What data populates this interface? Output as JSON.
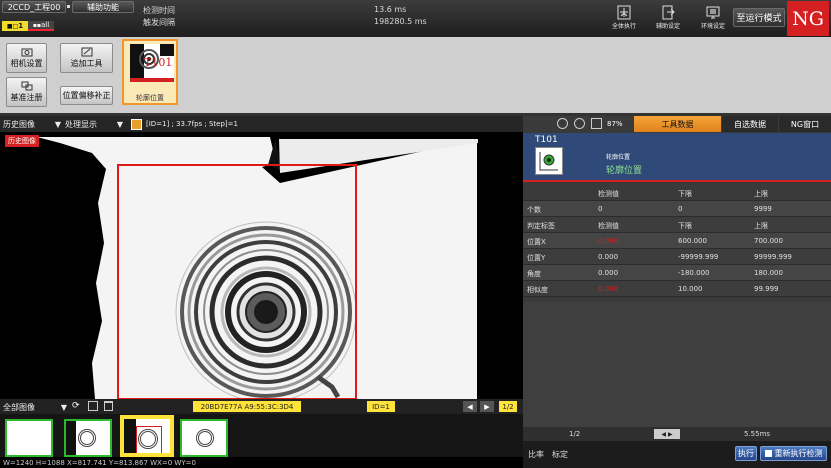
{
  "header": {
    "project_tab": "2CCD_工程00",
    "aux_tab": "辅助功能",
    "tab_small_1": "1",
    "tab_small_2": "all",
    "detect_time_label": "检测时间",
    "trigger_interval_label": "触发间隔",
    "detect_time_value": "13.6 ms",
    "trigger_interval_value": "198280.5 ms",
    "icons": [
      {
        "name": "all-execute",
        "label": "全体执行",
        "icon": "cross-icon"
      },
      {
        "name": "aux-settings",
        "label": "辅助设定",
        "icon": "export-icon"
      },
      {
        "name": "env-settings",
        "label": "环境设定",
        "icon": "monitor-icon"
      }
    ],
    "run_mode_button": "至运行模式",
    "ng_badge": "NG"
  },
  "tools": {
    "camera_settings": "相机设置",
    "register_base": "基准注册",
    "add_tool": "追加工具",
    "offset_correction": "位置偏移补正",
    "tool_card_label": "轮廓位置",
    "tool_card_id": "T101"
  },
  "view": {
    "history_select": "历史图像",
    "process_select": "处理显示",
    "info": "[ID=1] ; 33.7fps ; Step]=1",
    "history_badge": "历史图像",
    "zoom": "87%"
  },
  "right_tabs": [
    "工具数据",
    "自选数据",
    "NG窗口"
  ],
  "tool_info": {
    "id": "T101",
    "category": "轮廓位置",
    "name": "轮廓位置"
  },
  "table": {
    "headers": [
      "",
      "检测值",
      "下限",
      "上限"
    ],
    "rows": [
      {
        "label": "个数",
        "value": "0",
        "low": "0",
        "high": "9999",
        "red": false
      },
      {
        "label": "判定标签",
        "value": "检测值",
        "low": "下限",
        "high": "上限",
        "red": false
      },
      {
        "label": "位置X",
        "value": "0.000",
        "low": "600.000",
        "high": "700.000",
        "red": true
      },
      {
        "label": "位置Y",
        "value": "0.000",
        "low": "-99999.999",
        "high": "99999.999",
        "red": false
      },
      {
        "label": "角度",
        "value": "0.000",
        "low": "-180.000",
        "high": "180.000",
        "red": false
      },
      {
        "label": "相似度",
        "value": "0.000",
        "low": "10.000",
        "high": "99.999",
        "red": true
      }
    ],
    "page": "1/2",
    "time": "5.55ms"
  },
  "right_bottom": {
    "compare": "比率",
    "calibrate": "标定",
    "execute": "执行",
    "redetect": "重新执行检测"
  },
  "bottom": {
    "all_images_select": "全部图像",
    "image_name": "20BD7E77A A9:55:3C:3D4",
    "id_badge": "ID=1",
    "page_badge": "1/2"
  },
  "status_text": "W=1240 H=1088 X=817.741 Y=813.867 WX=0 WY=0",
  "colors": {
    "accent_orange": "#f0962a",
    "ng_red": "#d42020",
    "ok_green": "#2db82d",
    "highlight_yellow": "#ffe23a"
  }
}
